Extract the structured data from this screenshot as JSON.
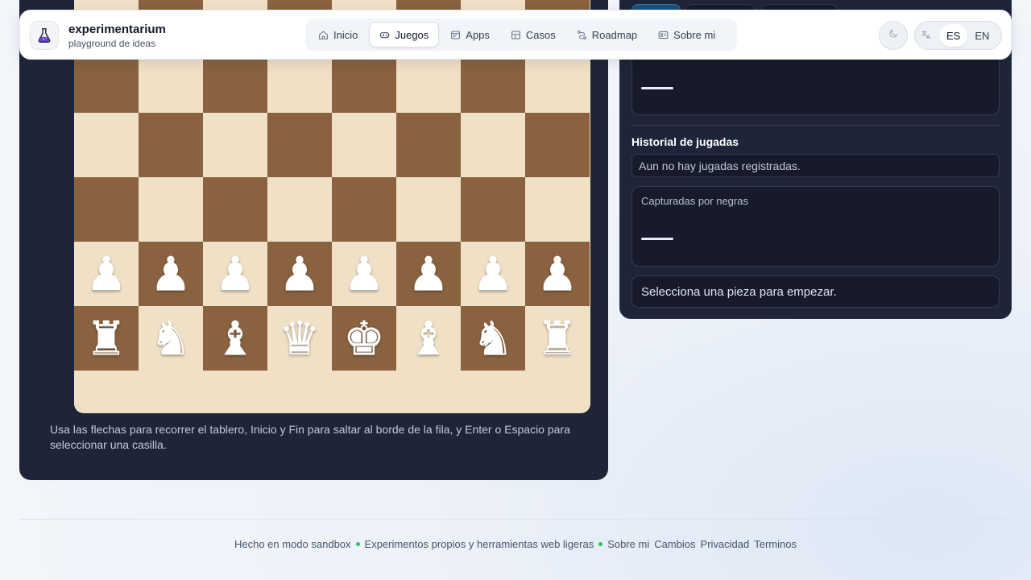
{
  "brand": {
    "name": "experimentarium",
    "tagline": "playground de ideas",
    "logo_icon": "flask-icon"
  },
  "nav": {
    "items": [
      {
        "label": "Inicio",
        "icon": "home-icon",
        "active": false
      },
      {
        "label": "Juegos",
        "icon": "gamepad-icon",
        "active": true
      },
      {
        "label": "Apps",
        "icon": "app-window-icon",
        "active": false
      },
      {
        "label": "Casos",
        "icon": "grid-icon",
        "active": false
      },
      {
        "label": "Roadmap",
        "icon": "route-icon",
        "active": false
      },
      {
        "label": "Sobre mi",
        "icon": "id-card-icon",
        "active": false
      }
    ]
  },
  "theme_toggle": {
    "icon": "moon-icon"
  },
  "language": {
    "icon": "translate-icon",
    "options": [
      "ES",
      "EN"
    ],
    "selected": "ES"
  },
  "board": {
    "top_row_partial": [
      "♟",
      "♟",
      "♟",
      "♟",
      "♟",
      "♟",
      "♟",
      "♟"
    ],
    "rows": [
      [
        "",
        "",
        "",
        "",
        "",
        "",
        "",
        ""
      ],
      [
        "",
        "",
        "",
        "",
        "",
        "",
        "",
        ""
      ],
      [
        "",
        "",
        "",
        "",
        "",
        "",
        "",
        ""
      ],
      [
        "",
        "",
        "",
        "",
        "",
        "",
        "",
        ""
      ],
      [
        "♟",
        "♟",
        "♟",
        "♟",
        "♟",
        "♟",
        "♟",
        "♟"
      ],
      [
        "♜",
        "♞",
        "♝",
        "♛",
        "♚",
        "♝",
        "♞",
        "♜"
      ]
    ],
    "help_text": "Usa las flechas para recorrer el tablero, Inicio y Fin para saltar al borde de la fila, y Enter o Espacio para seleccionar una casilla."
  },
  "side": {
    "history_title": "Historial de jugadas",
    "history_empty": "Aun no hay jugadas registradas.",
    "captured_by_black_label": "Capturadas por negras",
    "status": "Selecciona una pieza para empezar."
  },
  "footer": {
    "made_in": "Hecho en modo sandbox",
    "tagline": "Experimentos propios y herramientas web ligeras",
    "links": [
      "Sobre mi",
      "Cambios",
      "Privacidad",
      "Terminos"
    ]
  },
  "colors": {
    "panel_bg": "#1f2538",
    "light_square": "#f0e1c6",
    "dark_square": "#8a6240",
    "accent_green": "#22c55e"
  }
}
